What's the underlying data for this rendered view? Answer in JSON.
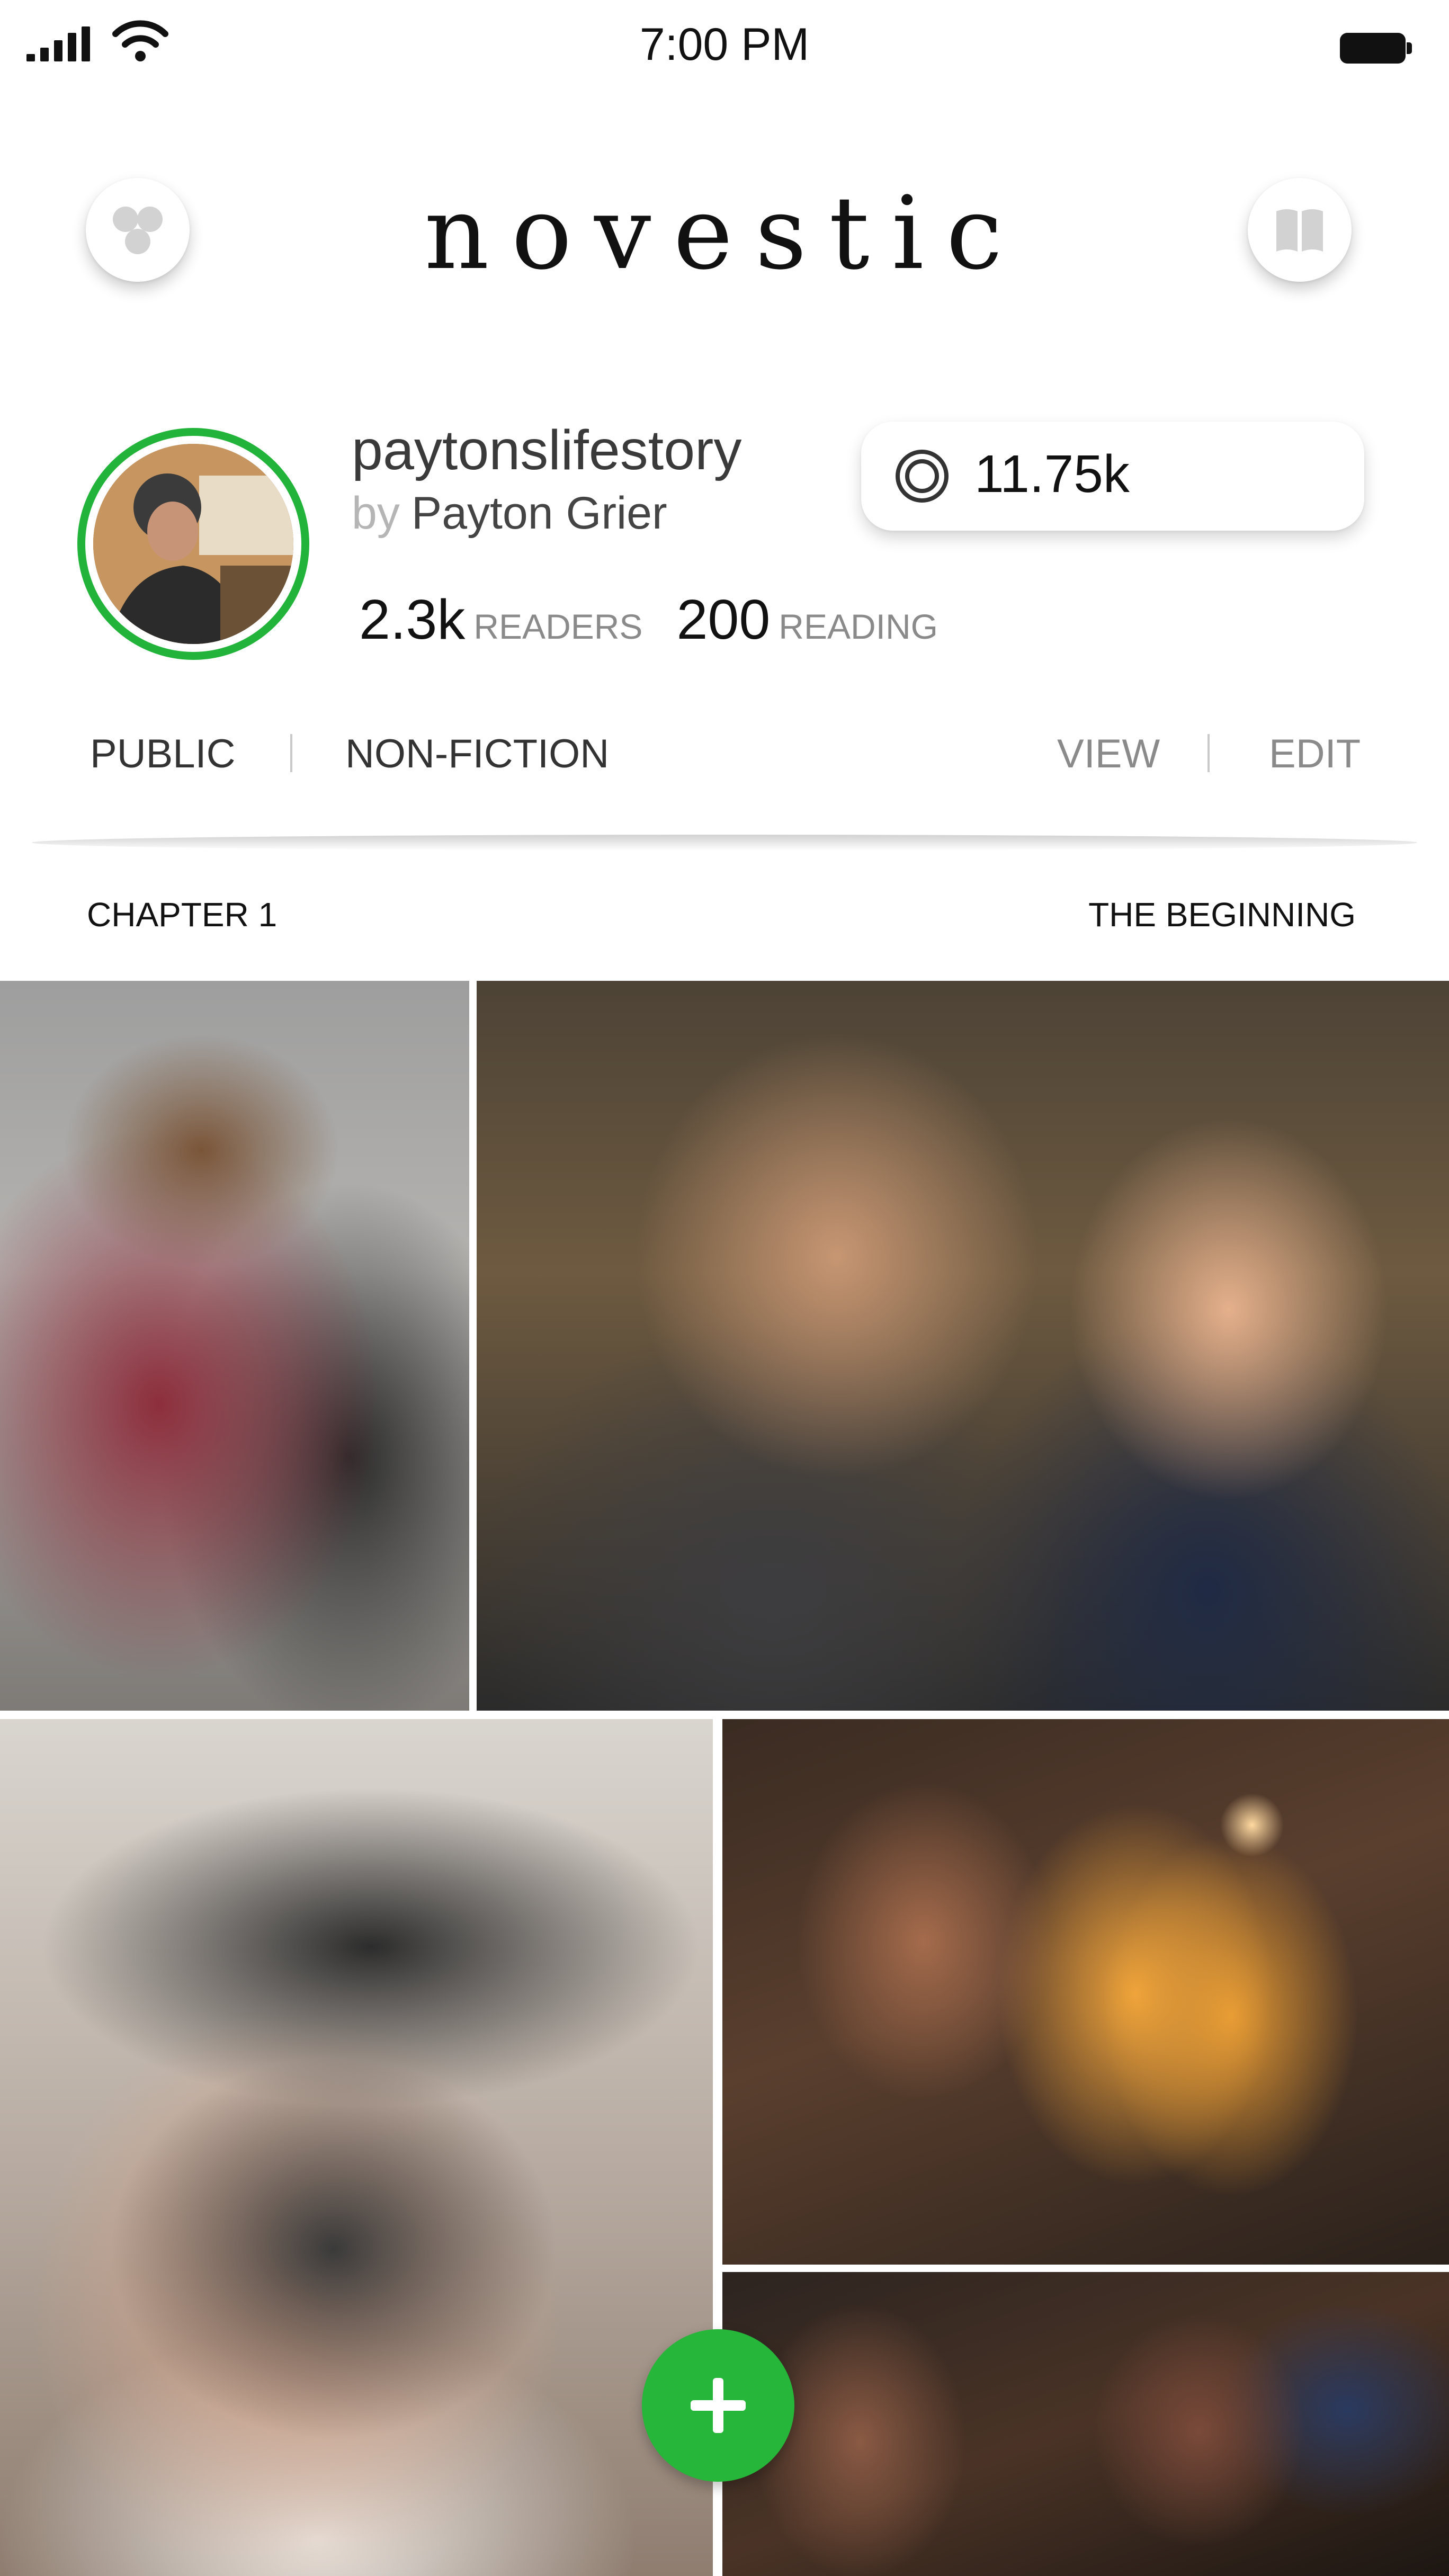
{
  "status_bar": {
    "time": "7:00 PM"
  },
  "header": {
    "brand": "novestic",
    "menu_icon": "circles-icon",
    "bookmark_icon": "book-icon"
  },
  "profile": {
    "username": "paytonslifestory",
    "by_prefix": "by",
    "author": "Payton Grier",
    "readers_count": "2.3k",
    "readers_label": "READERS",
    "reading_count": "200",
    "reading_label": "READING",
    "coins": "11.75k",
    "avatar_ring_color": "#22b43a"
  },
  "tabs": {
    "visibility": "PUBLIC",
    "genre": "NON-FICTION",
    "view": "VIEW",
    "edit": "EDIT"
  },
  "chapter": {
    "label": "CHAPTER 1",
    "title": "THE BEGINNING"
  },
  "fab": {
    "icon": "plus-icon",
    "color": "#25b63a"
  }
}
